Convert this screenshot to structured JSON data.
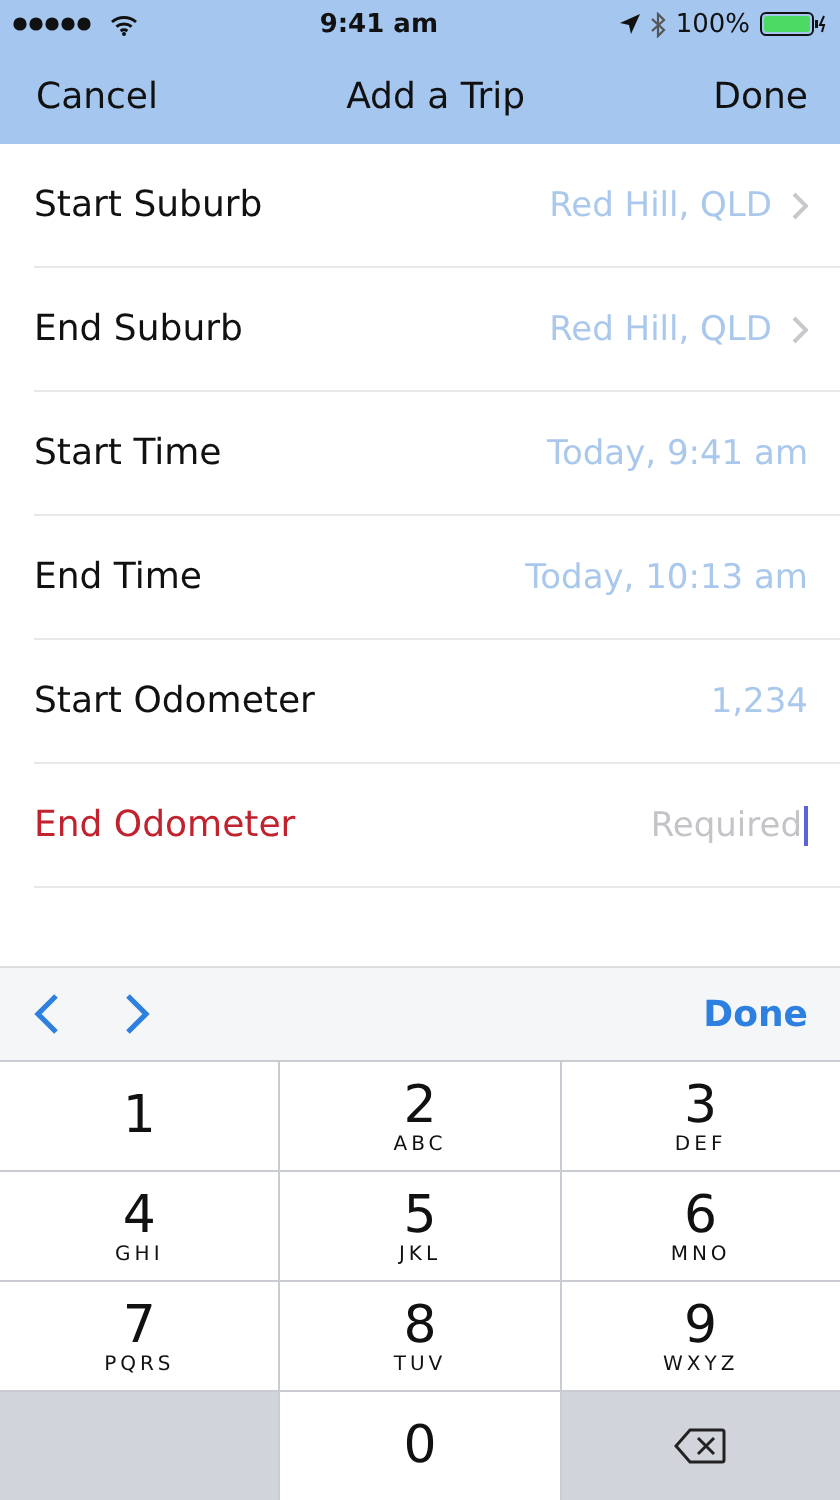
{
  "status_bar": {
    "time": "9:41 am",
    "battery": "100%"
  },
  "nav_bar": {
    "left": "Cancel",
    "title": "Add a Trip",
    "right": "Done"
  },
  "rows": [
    {
      "kind": "disclosure",
      "label": "Start Suburb",
      "value": "Red Hill, QLD",
      "invalid": false
    },
    {
      "kind": "disclosure",
      "label": "End Suburb",
      "value": "Red Hill, QLD",
      "invalid": false
    },
    {
      "kind": "value",
      "label": "Start Time",
      "value": "Today, 9:41 am",
      "invalid": false
    },
    {
      "kind": "value",
      "label": "End Time",
      "value": "Today, 10:13 am",
      "invalid": false
    },
    {
      "kind": "value",
      "label": "Start Odometer",
      "value": "1,234",
      "invalid": false
    },
    {
      "kind": "input",
      "label": "End Odometer",
      "placeholder": "Required",
      "invalid": true
    }
  ],
  "keyboard_toolbar": {
    "done": "Done"
  },
  "keys": [
    {
      "kind": "digit",
      "digit": "1"
    },
    {
      "kind": "digit",
      "digit": "2",
      "letters": "ABC"
    },
    {
      "kind": "digit",
      "digit": "3",
      "letters": "DEF"
    },
    {
      "kind": "digit",
      "digit": "4",
      "letters": "GHI"
    },
    {
      "kind": "digit",
      "digit": "5",
      "letters": "JKL"
    },
    {
      "kind": "digit",
      "digit": "6",
      "letters": "MNO"
    },
    {
      "kind": "digit",
      "digit": "7",
      "letters": "PQRS"
    },
    {
      "kind": "digit",
      "digit": "8",
      "letters": "TUV"
    },
    {
      "kind": "digit",
      "digit": "9",
      "letters": "WXYZ"
    },
    {
      "kind": "blank"
    },
    {
      "kind": "digit",
      "digit": "0"
    },
    {
      "kind": "delete"
    }
  ]
}
